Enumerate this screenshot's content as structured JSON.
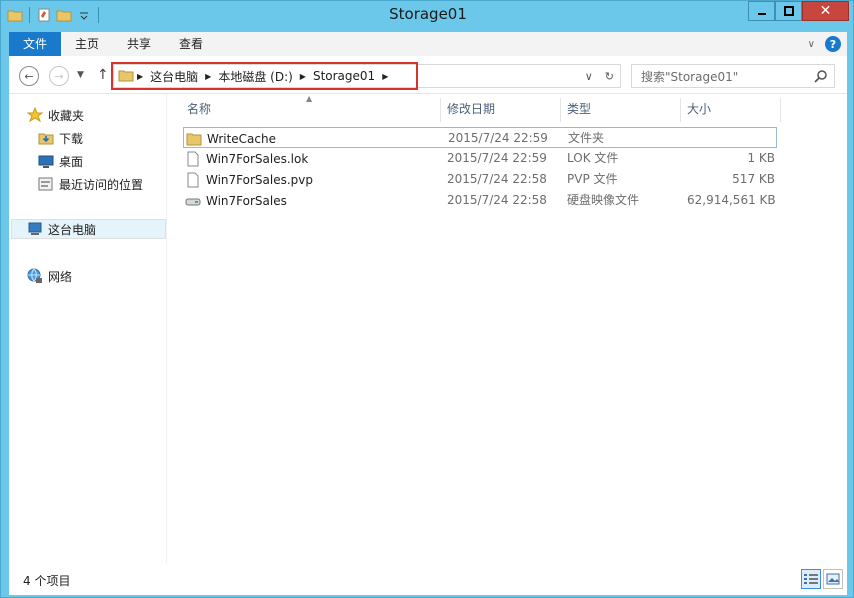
{
  "window": {
    "title": "Storage01"
  },
  "ribbon": {
    "tabs": [
      "文件",
      "主页",
      "共享",
      "查看"
    ]
  },
  "address": {
    "crumbs": [
      "这台电脑",
      "本地磁盘 (D:)",
      "Storage01"
    ],
    "search_placeholder": "搜索\"Storage01\""
  },
  "sidebar": {
    "favorites": "收藏夹",
    "downloads": "下载",
    "desktop": "桌面",
    "recent": "最近访问的位置",
    "thispc": "这台电脑",
    "network": "网络"
  },
  "columns": {
    "name": "名称",
    "date": "修改日期",
    "type": "类型",
    "size": "大小"
  },
  "files": [
    {
      "name": "WriteCache",
      "date": "2015/7/24 22:59",
      "type": "文件夹",
      "size": "",
      "icon": "folder-icon"
    },
    {
      "name": "Win7ForSales.lok",
      "date": "2015/7/24 22:59",
      "type": "LOK 文件",
      "size": "1 KB",
      "icon": "file-icon"
    },
    {
      "name": "Win7ForSales.pvp",
      "date": "2015/7/24 22:58",
      "type": "PVP 文件",
      "size": "517 KB",
      "icon": "file-icon"
    },
    {
      "name": "Win7ForSales",
      "date": "2015/7/24 22:58",
      "type": "硬盘映像文件",
      "size": "62,914,561 KB",
      "icon": "disk-image-icon"
    }
  ],
  "status": {
    "count": "4 个项目"
  }
}
